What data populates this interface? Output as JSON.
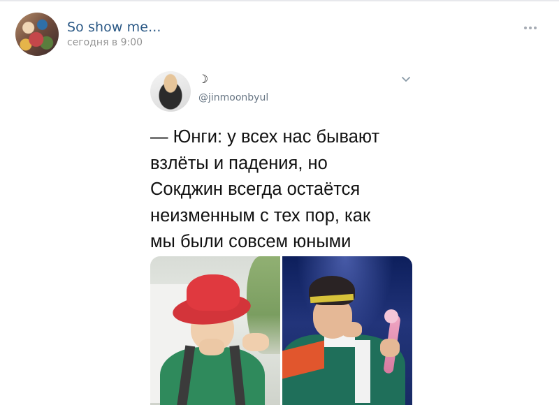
{
  "post": {
    "author": "So show me...",
    "time": "сегодня в 9:00",
    "more_icon": "ellipsis-horizontal-icon"
  },
  "tweet": {
    "name": "☽",
    "handle": "@jinmoonbyul",
    "menu_icon": "chevron-down-icon",
    "text_lines": [
      "— Юнги: у всех нас бывают",
      "взлёты и падения, но",
      "Сокджин всегда остаётся",
      "неизменным с тех пор, как",
      "мы были совсем юными"
    ]
  },
  "colors": {
    "author_link": "#2a5885",
    "timestamp": "#939393",
    "handle": "#687684",
    "divider": "#e7e8ec"
  }
}
